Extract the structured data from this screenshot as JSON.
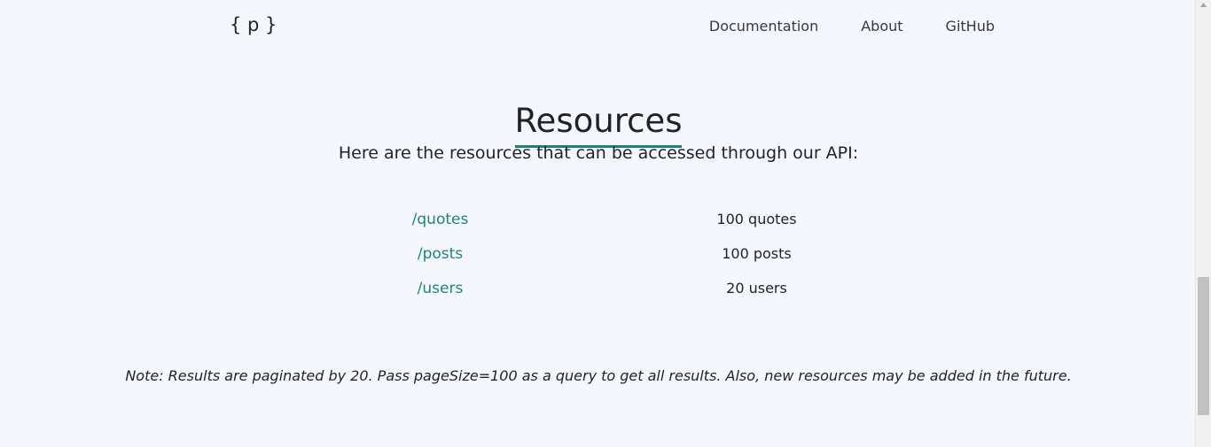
{
  "brand": {
    "logo": "{ p }"
  },
  "navigation": {
    "items": [
      {
        "label": "Documentation"
      },
      {
        "label": "About"
      },
      {
        "label": "GitHub"
      }
    ]
  },
  "resources": {
    "title": "Resources",
    "subtitle": "Here are the resources that can be accessed through our API:",
    "items": [
      {
        "path": "/quotes",
        "count": "100 quotes"
      },
      {
        "path": "/posts",
        "count": "100 posts"
      },
      {
        "path": "/users",
        "count": "20 users"
      }
    ],
    "note": "Note: Results are paginated by 20. Pass pageSize=100 as a query to get all results. Also, new resources may be added in the future."
  },
  "colors": {
    "background": "#f4f7fb",
    "accent": "#1f7f7a",
    "link": "#22837d"
  }
}
